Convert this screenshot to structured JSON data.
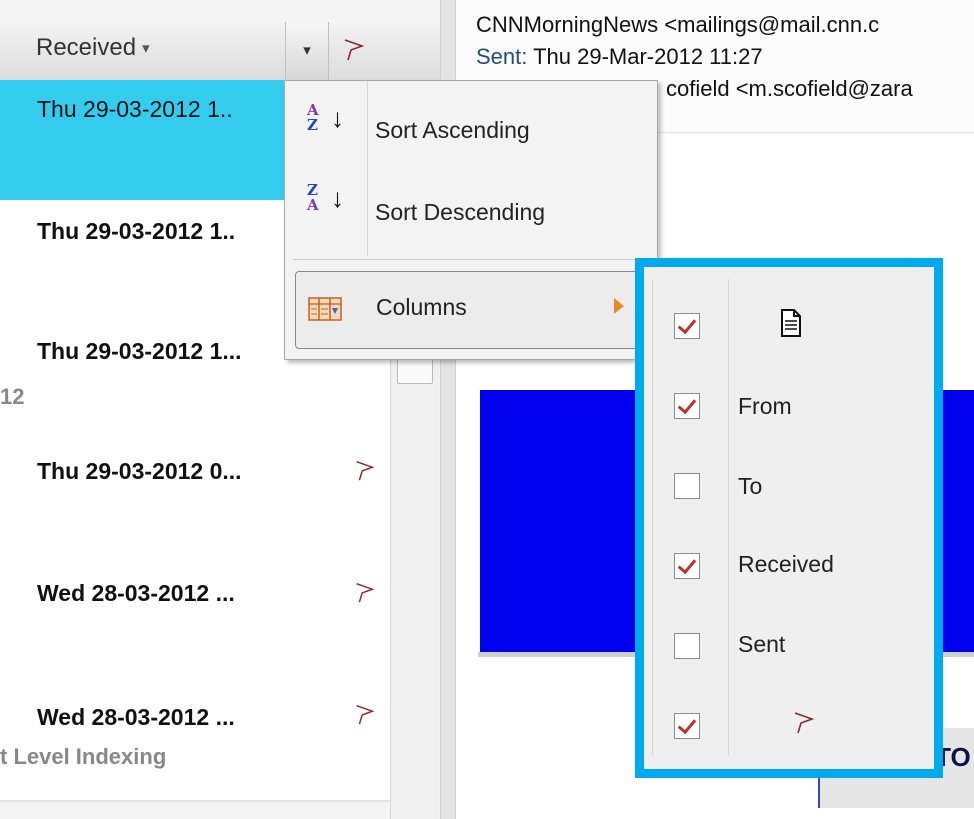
{
  "list": {
    "header": {
      "received_label": "Received",
      "caret": "▾",
      "dropdown_caret": "▾"
    },
    "rows": [
      {
        "date": "Thu 29-03-2012 1..",
        "sub": "",
        "selected": true
      },
      {
        "date": "Thu 29-03-2012 1..",
        "sub": ""
      },
      {
        "date": "Thu 29-03-2012 1...",
        "sub": "12"
      },
      {
        "date": "Thu 29-03-2012 0...",
        "sub": ""
      },
      {
        "date": "Wed 28-03-2012 ...",
        "sub": ""
      },
      {
        "date": "Wed 28-03-2012 ...",
        "sub": "t Level Indexing"
      }
    ]
  },
  "pane": {
    "from": "CNNMorningNews <mailings@mail.cnn.c",
    "sent_label": "Sent:",
    "sent_value": "Thu 29-Mar-2012 11:27",
    "to": "cofield <m.scofield@zara",
    "top_stories": "TOP STO"
  },
  "menu": {
    "sort_ascending": "Sort Ascending",
    "sort_descending": "Sort Descending",
    "columns": "Columns",
    "az_top": "A",
    "az_bottom": "Z",
    "za_top": "Z",
    "za_bottom": "A",
    "arrow": "↓"
  },
  "columns_submenu": {
    "items": [
      {
        "label": "",
        "icon": "document-icon",
        "checked": true
      },
      {
        "label": "From",
        "checked": true
      },
      {
        "label": "To",
        "checked": false
      },
      {
        "label": "Received",
        "checked": true
      },
      {
        "label": "Sent",
        "checked": false
      },
      {
        "label": "",
        "icon": "flag-icon",
        "checked": true
      }
    ]
  },
  "colors": {
    "selected_row": "#33ccee",
    "submenu_border": "#00aaee",
    "email_blue": "#0000ee",
    "check_mark": "#b33a2a",
    "submenu_arrow": "#e8892a"
  }
}
